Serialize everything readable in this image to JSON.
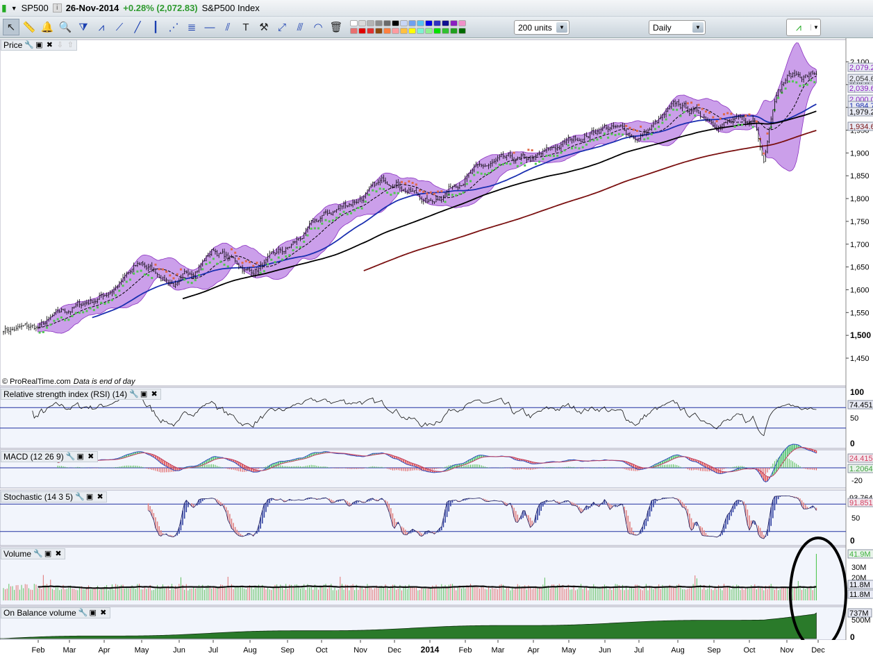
{
  "title_bar": {
    "symbol": "SP500",
    "date": "26-Nov-2014",
    "change": "+0.28% (2,072.83)",
    "name": "S&P500 Index",
    "info_icon": "i"
  },
  "toolbar": {
    "tools": [
      "pointer",
      "ruler",
      "alert-bell",
      "zoom",
      "triangle-pattern",
      "channel",
      "segment",
      "line",
      "vertical-line",
      "fibonacci-fan",
      "fibonacci-retracement",
      "horizontal-line",
      "trend-channel",
      "text",
      "settings-tools",
      "extend-line",
      "parallel-line",
      "arc",
      "trash"
    ],
    "colors_row1": [
      "#ffffff",
      "#d9d9d9",
      "#b3b3b3",
      "#8c8c8c",
      "#6b6b6b",
      "#000000",
      "#c8d6f5",
      "#6fa0f0",
      "#58c0f0",
      "#0000e0",
      "#3030c0",
      "#101090",
      "#8a20c0",
      "#f090c8"
    ],
    "colors_row2": [
      "#e87070",
      "#e00000",
      "#e03030",
      "#8a4a10",
      "#ff8040",
      "#ff9aa0",
      "#ffc040",
      "#ffff00",
      "#80f0d0",
      "#90f090",
      "#00e000",
      "#30c030",
      "#20a020",
      "#006a00"
    ],
    "units_select": "200 units",
    "period_select": "Daily",
    "indicator_button": "add-indicator"
  },
  "panels": {
    "price": "Price",
    "rsi": "Relative strength index (RSI) (14)",
    "macd": "MACD (12 26 9)",
    "stochastic": "Stochastic (14 3 5)",
    "volume": "Volume",
    "obv": "On Balance volume"
  },
  "credit": {
    "source": "© ProRealTime.com",
    "note": "Data is end of day"
  },
  "chart_data": {
    "type": "candlestick",
    "x_ticks": [
      "Feb",
      "Mar",
      "Apr",
      "May",
      "Jun",
      "Jul",
      "Aug",
      "Sep",
      "Oct",
      "Nov",
      "Dec",
      "2014",
      "Feb",
      "Mar",
      "Apr",
      "May",
      "Jun",
      "Jul",
      "Aug",
      "Sep",
      "Oct",
      "Nov",
      "Dec"
    ],
    "monthly_close": [
      1515,
      1555,
      1590,
      1655,
      1610,
      1690,
      1640,
      1685,
      1755,
      1805,
      1845,
      1790,
      1855,
      1875,
      1880,
      1925,
      1960,
      1935,
      2000,
      1975,
      1960,
      2072
    ],
    "price_ylim": [
      1420,
      2110
    ],
    "price_ticks": [
      "2,100",
      "2,050",
      "2,000",
      "1,950",
      "1,900",
      "1,850",
      "1,800",
      "1,750",
      "1,700",
      "1,650",
      "1,600",
      "1,550",
      "1,500",
      "1,450"
    ],
    "price_values": [
      {
        "v": "2,079.2",
        "c": "#8a20c0"
      },
      {
        "v": "2,054.6",
        "c": "#333"
      },
      {
        "v": "2,039.6",
        "c": "#8a20c0"
      },
      {
        "v": "2,000.0",
        "c": "#8a20c0"
      },
      {
        "v": "1,984.7",
        "c": "#1a2fb0"
      },
      {
        "v": "1,979.2",
        "c": "#000"
      },
      {
        "v": "1,934.6",
        "c": "#7a1010"
      }
    ],
    "rsi": {
      "ticks": [
        "100",
        "50",
        "0"
      ],
      "last": "74.451",
      "levels": [
        70,
        30
      ]
    },
    "macd": {
      "ticks": [
        "-20"
      ],
      "macd_last": "24.415",
      "signal_last": "1.2064"
    },
    "stochastic": {
      "ticks": [
        "50",
        "0"
      ],
      "k_last": "93.764",
      "d_last": "91.851",
      "levels": [
        80,
        20
      ]
    },
    "volume": {
      "ticks": [
        "30M",
        "20M"
      ],
      "last": "41.9M",
      "avg": "11.8M",
      "avg2": "11.8M"
    },
    "obv": {
      "ticks": [
        "500M",
        "0"
      ],
      "last": "737M"
    },
    "colors": {
      "bands": "#a050d8",
      "ma50": "#1a2fb0",
      "ma100": "#000000",
      "ma200": "#7a1010",
      "sar_up": "#50c850",
      "sar_down": "#e06848",
      "volume": "#50c050",
      "obv": "#2a7a2a"
    },
    "annotation": "black ellipse around latest volume spike"
  }
}
